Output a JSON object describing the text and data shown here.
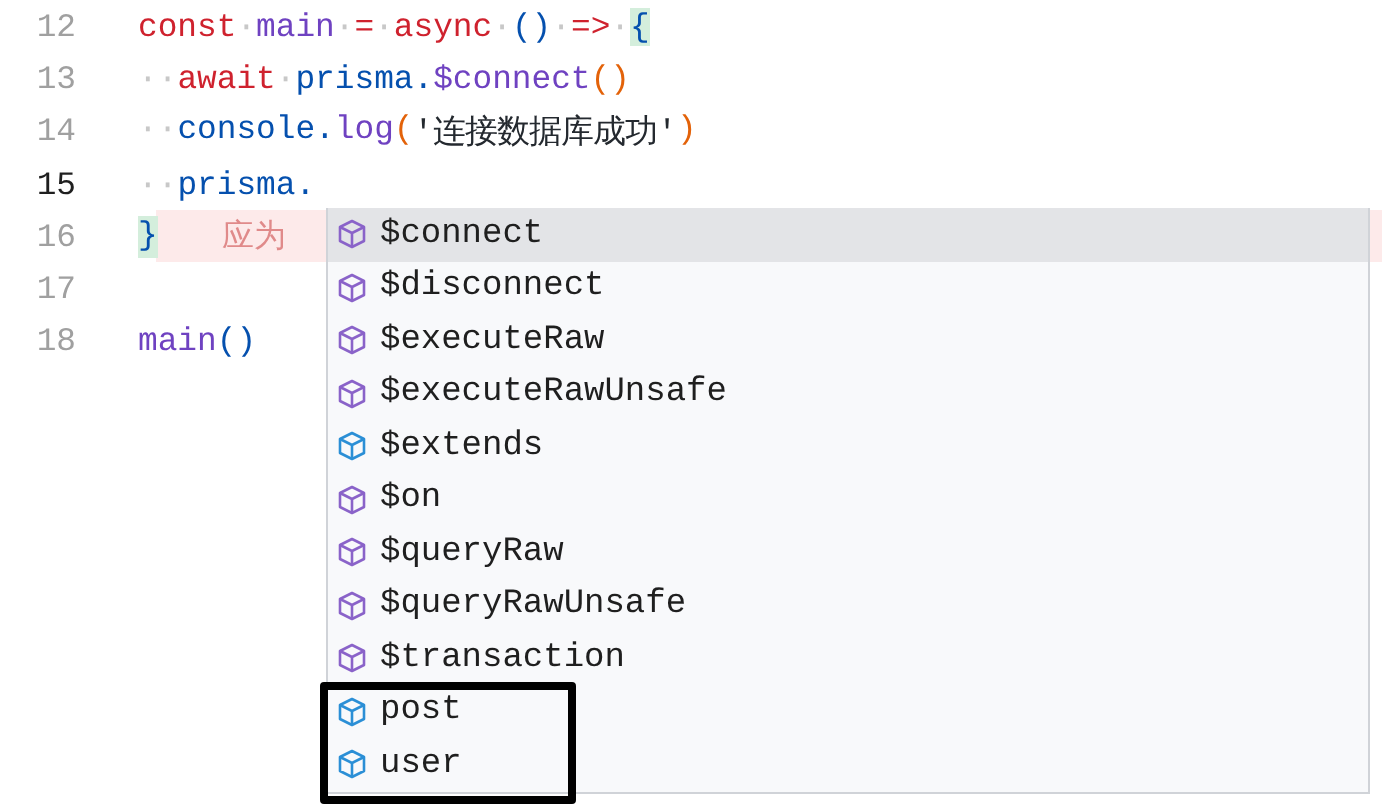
{
  "editor": {
    "lines": [
      {
        "number": "12",
        "current": false,
        "error": false,
        "tokens": [
          {
            "text": "const",
            "kind": "keyword"
          },
          {
            "text": "·",
            "kind": "ws"
          },
          {
            "text": "main",
            "kind": "func"
          },
          {
            "text": "·",
            "kind": "ws"
          },
          {
            "text": "=",
            "kind": "keyword"
          },
          {
            "text": "·",
            "kind": "ws"
          },
          {
            "text": "async",
            "kind": "keyword"
          },
          {
            "text": "·",
            "kind": "ws"
          },
          {
            "text": "()",
            "kind": "var"
          },
          {
            "text": "·",
            "kind": "ws"
          },
          {
            "text": "=>",
            "kind": "keyword"
          },
          {
            "text": "·",
            "kind": "ws"
          },
          {
            "text": "{",
            "kind": "var",
            "match": true
          }
        ]
      },
      {
        "number": "13",
        "current": false,
        "error": false,
        "tokens": [
          {
            "text": "··",
            "kind": "ws"
          },
          {
            "text": "await",
            "kind": "keyword"
          },
          {
            "text": "·",
            "kind": "ws"
          },
          {
            "text": "prisma.",
            "kind": "var"
          },
          {
            "text": "$connect",
            "kind": "func"
          },
          {
            "text": "()",
            "kind": "paren"
          }
        ]
      },
      {
        "number": "14",
        "current": false,
        "error": false,
        "tokens": [
          {
            "text": "··",
            "kind": "ws"
          },
          {
            "text": "console.",
            "kind": "var"
          },
          {
            "text": "log",
            "kind": "func"
          },
          {
            "text": "(",
            "kind": "paren"
          },
          {
            "text": "'连接数据库成功'",
            "kind": "string"
          },
          {
            "text": ")",
            "kind": "paren"
          }
        ]
      },
      {
        "number": "15",
        "current": true,
        "error": false,
        "tokens": [
          {
            "text": "··",
            "kind": "ws"
          },
          {
            "text": "prisma.",
            "kind": "var"
          }
        ]
      },
      {
        "number": "16",
        "current": false,
        "error": true,
        "tokens": [
          {
            "text": "}",
            "kind": "var",
            "match": true
          },
          {
            "text": "应为",
            "kind": "hint"
          }
        ]
      },
      {
        "number": "17",
        "current": false,
        "error": false
      },
      {
        "number": "18",
        "current": false,
        "error": false,
        "tokens": [
          {
            "text": "main",
            "kind": "func"
          },
          {
            "text": "()",
            "kind": "var"
          }
        ]
      }
    ]
  },
  "suggestions": [
    {
      "label": "$connect",
      "kind": "method",
      "selected": true,
      "boxed": false
    },
    {
      "label": "$disconnect",
      "kind": "method",
      "selected": false,
      "boxed": false
    },
    {
      "label": "$executeRaw",
      "kind": "method",
      "selected": false,
      "boxed": false
    },
    {
      "label": "$executeRawUnsafe",
      "kind": "method",
      "selected": false,
      "boxed": false
    },
    {
      "label": "$extends",
      "kind": "field",
      "selected": false,
      "boxed": false
    },
    {
      "label": "$on",
      "kind": "method",
      "selected": false,
      "boxed": false
    },
    {
      "label": "$queryRaw",
      "kind": "method",
      "selected": false,
      "boxed": false
    },
    {
      "label": "$queryRawUnsafe",
      "kind": "method",
      "selected": false,
      "boxed": false
    },
    {
      "label": "$transaction",
      "kind": "method",
      "selected": false,
      "boxed": false
    },
    {
      "label": "post",
      "kind": "field",
      "selected": false,
      "boxed": true
    },
    {
      "label": "user",
      "kind": "field",
      "selected": false,
      "boxed": true
    }
  ]
}
